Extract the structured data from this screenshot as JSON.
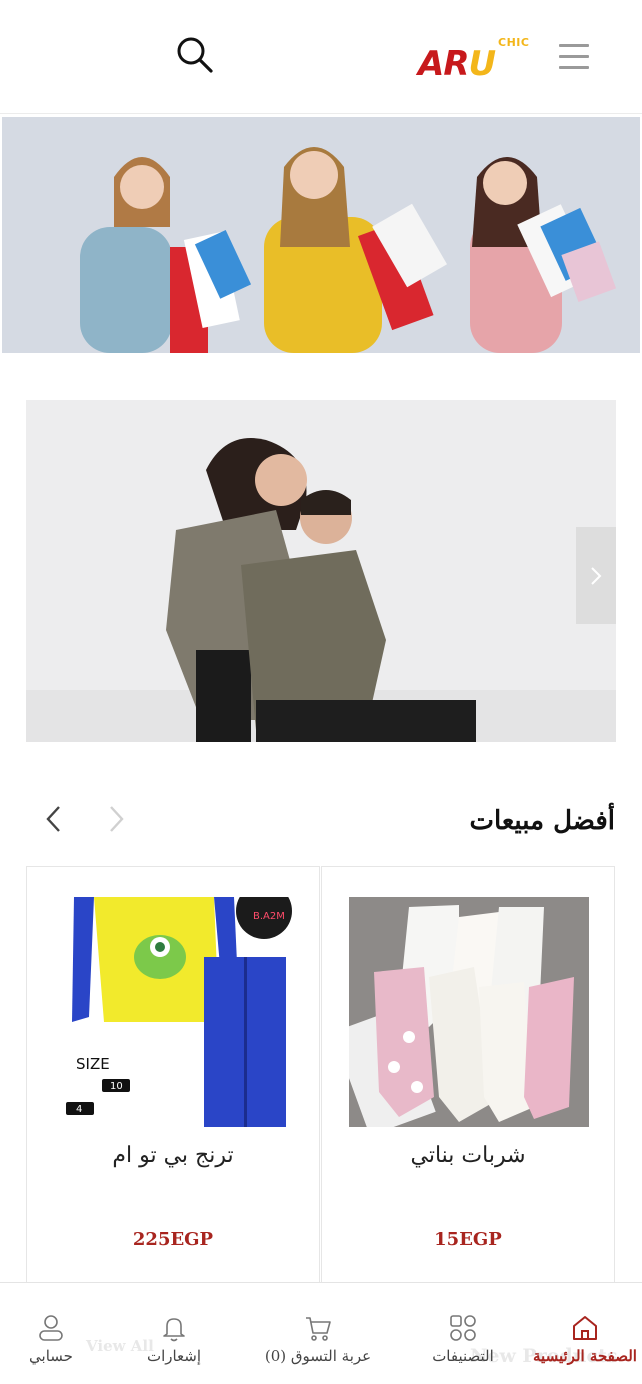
{
  "header": {
    "logo_main_a": "AR",
    "logo_main_u": "U",
    "logo_chic": "CHIC"
  },
  "section": {
    "title": "أفضل مبيعات"
  },
  "products": [
    {
      "name": "شربات بناتي",
      "price": "15EGP"
    },
    {
      "name": "ترنج بي تو ام",
      "price": "225EGP",
      "badge": "B.A2M"
    }
  ],
  "product_images": {
    "size_label": "SIZE",
    "size_10": "10",
    "size_4": "4"
  },
  "bottom_nav": {
    "ghost_new_products": "New Products",
    "ghost_view_all": "View All",
    "items": [
      {
        "label": "الصفحة الرئيسية",
        "icon": "home-icon",
        "active": true
      },
      {
        "label": "التصنيفات",
        "icon": "grid-icon",
        "active": false
      },
      {
        "label": "عربة التسوق (0)",
        "icon": "cart-icon",
        "active": false
      },
      {
        "label": "إشعارات",
        "icon": "bell-icon",
        "active": false
      },
      {
        "label": "حسابي",
        "icon": "user-icon",
        "active": false
      }
    ]
  },
  "colors": {
    "brand_red": "#c7191c",
    "brand_yellow": "#f3b61a",
    "price": "#a8251f"
  }
}
